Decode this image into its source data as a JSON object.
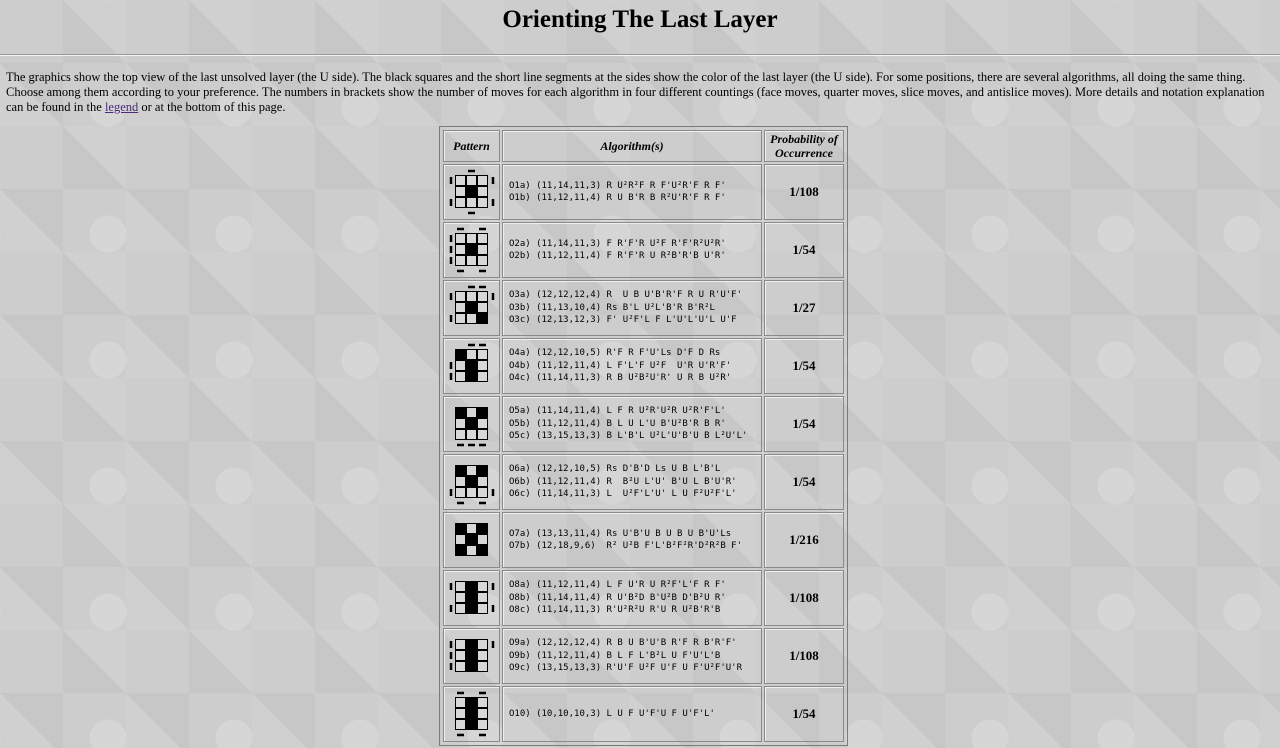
{
  "title": "Orienting The Last Layer",
  "intro": {
    "before_link": "The graphics show the top view of the last unsolved layer (the U side). The black squares and the short line segments at the sides show the color of the last layer (the U side). For some positions, there are several algorithms, all doing the same thing. Choose among them according to your preference. The numbers in brackets show the number of moves for each algorithm in four different countings (face moves, quarter moves, slice moves, and antislice moves). More details and notation explanation can be found in the ",
    "link_text": "legend",
    "after_link": " or at the bottom of this page."
  },
  "table": {
    "headers": {
      "pattern": "Pattern",
      "algorithms": "Algorithm(s)",
      "probability": "Probability of Occurrence"
    },
    "rows": [
      {
        "id": "O1",
        "cells": [
          0,
          0,
          0,
          0,
          1,
          0,
          0,
          0,
          0
        ],
        "bars": {
          "top": [
            1
          ],
          "bottom": [
            1
          ],
          "left": [
            0,
            2
          ],
          "right": [
            0,
            2
          ]
        },
        "algorithms": [
          "O1a) (11,14,11,3) R U²R²F R F'U²R'F R F'",
          "O1b) (11,12,11,4) R U B'R B R²U'R'F R F'"
        ],
        "probability": "1/108"
      },
      {
        "id": "O2",
        "cells": [
          0,
          0,
          0,
          0,
          1,
          0,
          0,
          0,
          0
        ],
        "bars": {
          "top": [
            0,
            2
          ],
          "bottom": [
            0,
            2
          ],
          "left": [
            0,
            1,
            2
          ],
          "right": []
        },
        "algorithms": [
          "O2a) (11,14,11,3) F R'F'R U²F R'F'R²U²R'",
          "O2b) (11,12,11,4) F R'F'R U R²B'R'B U'R'"
        ],
        "probability": "1/54"
      },
      {
        "id": "O3",
        "cells": [
          0,
          0,
          0,
          0,
          1,
          0,
          0,
          0,
          1
        ],
        "bars": {
          "top": [
            1,
            2
          ],
          "bottom": [],
          "left": [
            0,
            2
          ],
          "right": [
            0
          ]
        },
        "algorithms": [
          "O3a) (12,12,12,4) R  U B U'B'R'F R U R'U'F'",
          "O3b) (11,13,10,4) Rs B'L U²L'B'R B'R²L",
          "O3c) (12,13,12,3) F' U²F'L F L'U'L'U'L U'F"
        ],
        "probability": "1/27"
      },
      {
        "id": "O4",
        "cells": [
          1,
          0,
          0,
          0,
          1,
          0,
          0,
          1,
          0
        ],
        "bars": {
          "top": [
            1,
            2
          ],
          "bottom": [],
          "left": [
            1,
            2
          ],
          "right": []
        },
        "algorithms": [
          "O4a) (12,12,10,5) R'F R F'U'Ls D'F D Rs",
          "O4b) (11,12,11,4) L F'L'F U²F  U'R U'R'F'",
          "O4c) (11,14,11,3) R B U²B²U'R' U R B U²R'"
        ],
        "probability": "1/54"
      },
      {
        "id": "O5",
        "cells": [
          1,
          0,
          1,
          0,
          1,
          0,
          0,
          0,
          0
        ],
        "bars": {
          "top": [],
          "bottom": [
            0,
            1,
            2
          ],
          "left": [],
          "right": []
        },
        "algorithms": [
          "O5a) (11,14,11,4) L F R U²R'U²R U²R'F'L'",
          "O5b) (11,12,11,4) B L U L'U B'U²B'R B R'",
          "O5c) (13,15,13,3) B L'B'L U²L'U'B'U B L²U'L'"
        ],
        "probability": "1/54"
      },
      {
        "id": "O6",
        "cells": [
          1,
          0,
          1,
          0,
          1,
          0,
          0,
          0,
          0
        ],
        "bars": {
          "top": [],
          "bottom": [
            0,
            2
          ],
          "left": [
            2
          ],
          "right": [
            2
          ]
        },
        "algorithms": [
          "O6a) (12,12,10,5) Rs D'B'D Ls U B L'B'L",
          "O6b) (11,12,11,4) R  B²U L'U' B'U L B'U'R'",
          "O6c) (11,14,11,3) L  U²F'L'U' L U F²U²F'L'"
        ],
        "probability": "1/54"
      },
      {
        "id": "O7",
        "cells": [
          1,
          0,
          1,
          0,
          1,
          0,
          1,
          0,
          1
        ],
        "bars": {
          "top": [],
          "bottom": [],
          "left": [],
          "right": []
        },
        "algorithms": [
          "O7a) (13,13,11,4) Rs U'B'U B U B U B'U'Ls",
          "O7b) (12,18,9,6)  R² U²B F'L'B²F²R'D²R²B F'"
        ],
        "probability": "1/216"
      },
      {
        "id": "O8",
        "cells": [
          0,
          1,
          0,
          0,
          1,
          0,
          0,
          1,
          0
        ],
        "bars": {
          "top": [],
          "bottom": [],
          "left": [
            0,
            2
          ],
          "right": [
            0,
            2
          ]
        },
        "algorithms": [
          "O8a) (11,12,11,4) L F U'R U R²F'L'F R F'",
          "O8b) (11,14,11,4) R U'B²D B'U²B D'B²U R'",
          "O8c) (11,14,11,3) R'U²R²U R'U R U²B'R'B"
        ],
        "probability": "1/108"
      },
      {
        "id": "O9",
        "cells": [
          0,
          1,
          0,
          0,
          1,
          0,
          0,
          1,
          0
        ],
        "bars": {
          "top": [],
          "bottom": [],
          "left": [
            0,
            1,
            2
          ],
          "right": [
            0
          ]
        },
        "algorithms": [
          "O9a) (12,12,12,4) R B U B'U'B R'F R B'R'F'",
          "O9b) (11,12,11,4) B L F L'B²L U F'U'L'B",
          "O9c) (13,15,13,3) R'U'F U²F U'F U F'U²F'U'R"
        ],
        "probability": "1/108"
      },
      {
        "id": "O10",
        "cells": [
          0,
          1,
          0,
          0,
          1,
          0,
          0,
          1,
          0
        ],
        "bars": {
          "top": [
            0,
            2
          ],
          "bottom": [
            0,
            2
          ],
          "left": [],
          "right": []
        },
        "algorithms": [
          "O10) (10,10,10,3) L U F U'F'U F U'F'L'"
        ],
        "probability": "1/54"
      }
    ]
  }
}
